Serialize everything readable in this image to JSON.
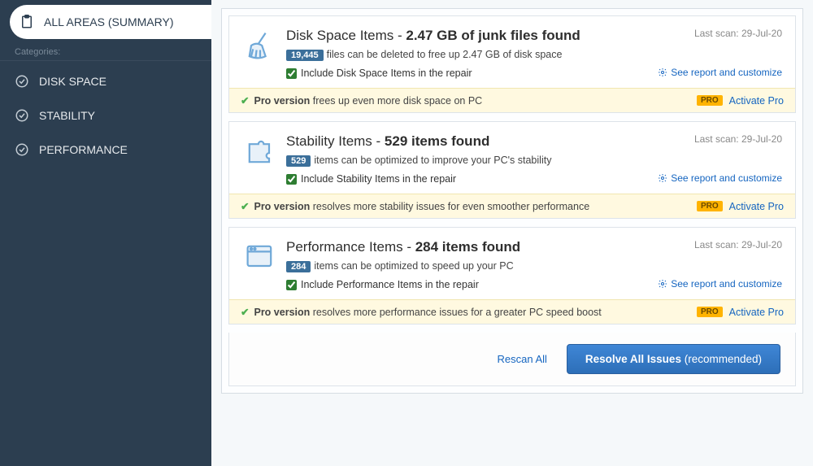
{
  "sidebar": {
    "all_areas": "ALL AREAS (SUMMARY)",
    "categories_label": "Categories:",
    "items": [
      {
        "label": "DISK SPACE"
      },
      {
        "label": "STABILITY"
      },
      {
        "label": "PERFORMANCE"
      }
    ]
  },
  "cards": [
    {
      "title_prefix": "Disk Space Items - ",
      "title_bold": "2.47 GB of junk files found",
      "badge": "19,445",
      "subline": "files can be deleted to free up 2.47 GB of disk space",
      "checkbox_label": "Include Disk Space Items in the repair",
      "last_scan": "Last scan: 29-Jul-20",
      "report_link": "See report and customize",
      "pro_bold": "Pro version",
      "pro_rest": " frees up even more disk space on PC",
      "pro_badge": "PRO",
      "activate": "Activate Pro"
    },
    {
      "title_prefix": "Stability Items - ",
      "title_bold": "529 items found",
      "badge": "529",
      "subline": "items can be optimized to improve your PC's stability",
      "checkbox_label": "Include Stability Items in the repair",
      "last_scan": "Last scan: 29-Jul-20",
      "report_link": "See report and customize",
      "pro_bold": "Pro version",
      "pro_rest": " resolves more stability issues for even smoother performance",
      "pro_badge": "PRO",
      "activate": "Activate Pro"
    },
    {
      "title_prefix": "Performance Items - ",
      "title_bold": "284 items found",
      "badge": "284",
      "subline": "items can be optimized to speed up your PC",
      "checkbox_label": "Include Performance Items in the repair",
      "last_scan": "Last scan: 29-Jul-20",
      "report_link": "See report and customize",
      "pro_bold": "Pro version",
      "pro_rest": " resolves more performance issues for a greater PC speed boost",
      "pro_badge": "PRO",
      "activate": "Activate Pro"
    }
  ],
  "footer": {
    "rescan": "Rescan All",
    "resolve_bold": "Resolve All Issues",
    "resolve_paren": " (recommended)"
  }
}
